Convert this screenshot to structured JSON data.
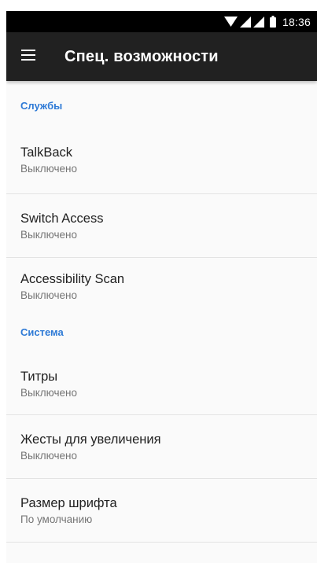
{
  "status_bar": {
    "time": "18:36",
    "icons": [
      "wifi-icon",
      "signal-icon",
      "signal-icon",
      "battery-icon"
    ]
  },
  "app_bar": {
    "menu_icon": "menu-icon",
    "title": "Спец. возможности"
  },
  "sections": [
    {
      "header": "Службы",
      "items": [
        {
          "title": "TalkBack",
          "summary": "Выключено"
        },
        {
          "title": "Switch Access",
          "summary": "Выключено"
        },
        {
          "title": "Accessibility Scan",
          "summary": "Выключено"
        }
      ]
    },
    {
      "header": "Система",
      "items": [
        {
          "title": "Титры",
          "summary": "Выключено"
        },
        {
          "title": "Жесты для увеличения",
          "summary": "Выключено"
        },
        {
          "title": "Размер шрифта",
          "summary": "По умолчанию"
        }
      ]
    }
  ],
  "colors": {
    "app_bar": "#212121",
    "status_bar": "#000000",
    "accent": "#2e7ad6",
    "background": "#fafafa"
  }
}
